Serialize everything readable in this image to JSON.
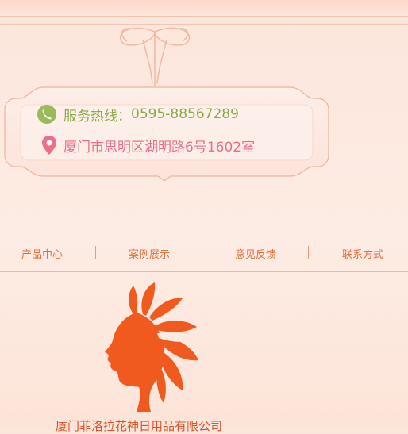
{
  "contact": {
    "hotline_label": "服务热线：",
    "hotline_number": "0595-88567289",
    "address": "厦门市思明区湖明路6号1602室"
  },
  "nav": {
    "items": [
      {
        "label": "产品中心"
      },
      {
        "label": "案例展示"
      },
      {
        "label": "意见反馈"
      },
      {
        "label": "联系方式"
      }
    ]
  },
  "brand": {
    "company_name": "厦门菲洛拉花神日用品有限公司",
    "accent_color": "#f05a1e",
    "phone_color": "#8aa84a",
    "address_color": "#ea6f86"
  },
  "icons": {
    "phone": "phone-icon",
    "location": "location-pin-icon",
    "logo": "flower-woman-logo"
  }
}
